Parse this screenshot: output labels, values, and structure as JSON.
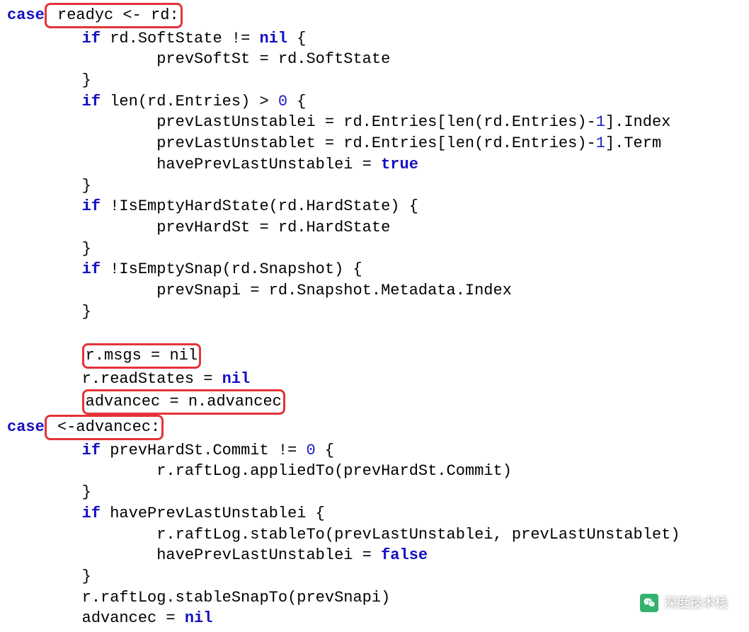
{
  "code": {
    "l01a": "case",
    "l01b": " readyc <- rd:",
    "l02a": "        if",
    "l02b": " rd.SoftState != ",
    "l02c": "nil",
    "l02d": " {",
    "l03": "                prevSoftSt = rd.SoftState",
    "l04": "        }",
    "l05a": "        if",
    "l05b": " len(rd.Entries) > ",
    "l05c": "0",
    "l05d": " {",
    "l06a": "                prevLastUnstablei = rd.Entries[len(rd.Entries)-",
    "l06b": "1",
    "l06c": "].Index",
    "l07a": "                prevLastUnstablet = rd.Entries[len(rd.Entries)-",
    "l07b": "1",
    "l07c": "].Term",
    "l08a": "                havePrevLastUnstablei = ",
    "l08b": "true",
    "l09": "        }",
    "l10a": "        if",
    "l10b": " !IsEmptyHardState(rd.HardState) {",
    "l11": "                prevHardSt = rd.HardState",
    "l12": "        }",
    "l13a": "        if",
    "l13b": " !IsEmptySnap(rd.Snapshot) {",
    "l14": "                prevSnapi = rd.Snapshot.Metadata.Index",
    "l15": "        }",
    "l16": "",
    "l17a": "        ",
    "l17b": "r.msgs = nil",
    "l18a": "        r.readStates = ",
    "l18b": "nil",
    "l19a": "        ",
    "l19b": "advancec = n.advancec",
    "l20a": "case",
    "l20b": " <-advancec:",
    "l21a": "        if",
    "l21b": " prevHardSt.Commit != ",
    "l21c": "0",
    "l21d": " {",
    "l22": "                r.raftLog.appliedTo(prevHardSt.Commit)",
    "l23": "        }",
    "l24a": "        if",
    "l24b": " havePrevLastUnstablei {",
    "l25": "                r.raftLog.stableTo(prevLastUnstablei, prevLastUnstablet)",
    "l26a": "                havePrevLastUnstablei = ",
    "l26b": "false",
    "l27": "        }",
    "l28": "        r.raftLog.stableSnapTo(prevSnapi)",
    "l29a": "        advancec = ",
    "l29b": "nil"
  },
  "watermark": "深度技术栈"
}
